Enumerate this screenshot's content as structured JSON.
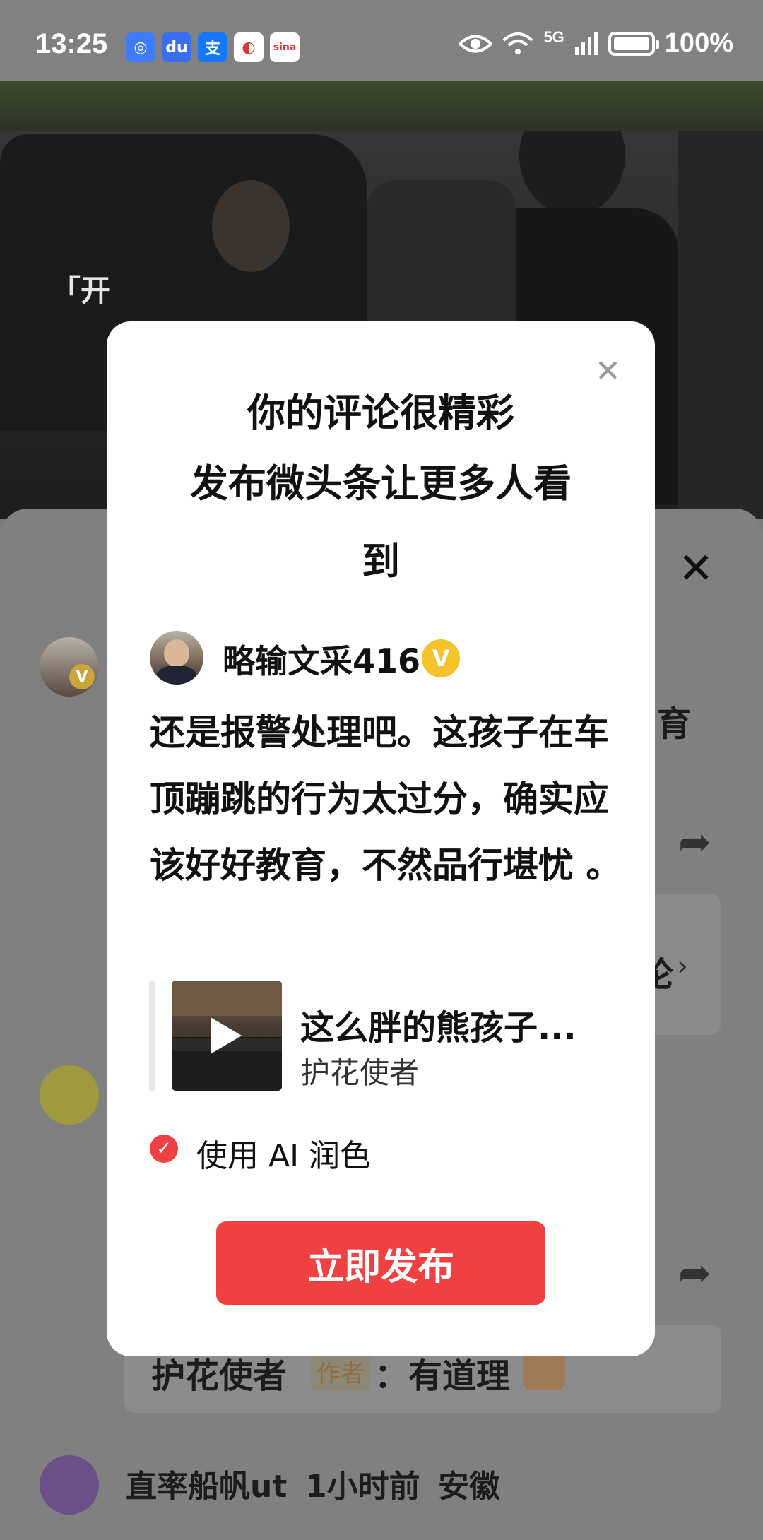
{
  "status_bar": {
    "time": "13:25",
    "network": "5G",
    "battery": "100%",
    "app_icons": [
      {
        "name": "scan-app-icon",
        "glyph": "◎",
        "bg": "#3d7bf7"
      },
      {
        "name": "baidu-icon",
        "glyph": "du",
        "bg": "#3a6df0"
      },
      {
        "name": "alipay-icon",
        "glyph": "支",
        "bg": "#1677ff"
      },
      {
        "name": "browser-icon",
        "glyph": "◐",
        "bg": "#ffffff"
      },
      {
        "name": "sina-icon",
        "glyph": "sina",
        "bg": "#ffffff"
      }
    ]
  },
  "video": {
    "caption": "「开"
  },
  "background": {
    "partial_right_text": "育",
    "partial_box_text": "论",
    "reply_author": "护花使者",
    "reply_author_tag": "作者",
    "reply_text": "：有道理",
    "last_comment": {
      "user": "直率船帆ut",
      "time": "1小时前",
      "location": "安徽"
    }
  },
  "modal": {
    "title_line1": "你的评论很精彩",
    "title_line2": "发布微头条让更多人看",
    "title_line3": "到",
    "user": {
      "name": "略输文采416",
      "badge": "V"
    },
    "comment": "还是报警处理吧。这孩子在车顶蹦跳的行为太过分，确实应该好好教育，不然品行堪忧 。",
    "quote": {
      "title": "这么胖的熊孩子...",
      "author": "护花使者"
    },
    "ai_polish_label": "使用 AI 润色",
    "ai_polish_checked": true,
    "publish_button": "立即发布",
    "close_glyph": "✕"
  },
  "colors": {
    "accent": "#f04142",
    "verified_badge": "#f4c22b"
  }
}
